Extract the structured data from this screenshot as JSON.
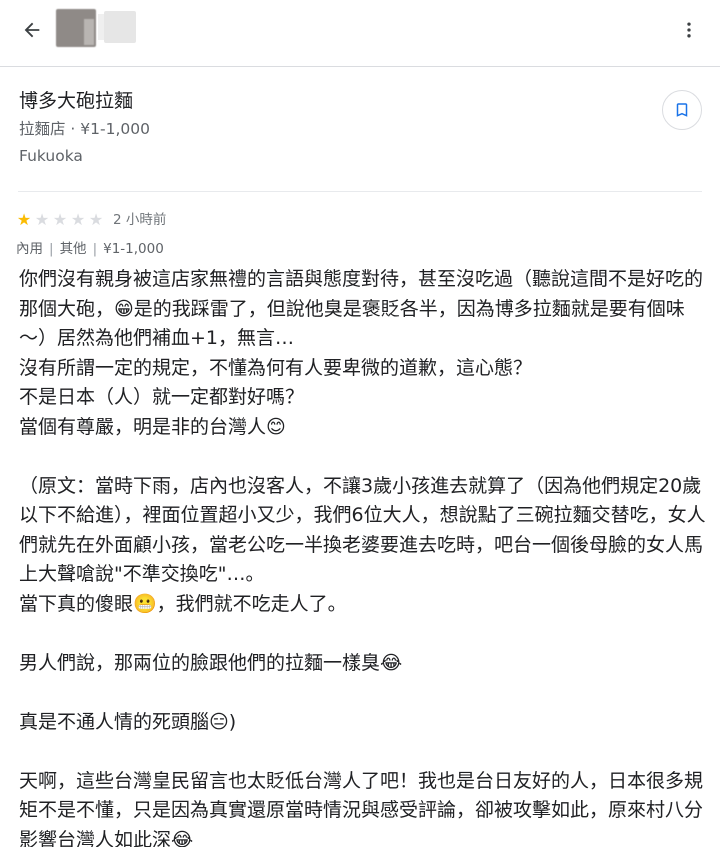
{
  "header": {
    "back_icon": "arrow-left-icon",
    "more_icon": "more-vert-icon"
  },
  "place": {
    "name": "博多大砲拉麵",
    "meta": "拉麵店 · ¥1-1,000",
    "city": "Fukuoka",
    "save_icon": "bookmark-icon"
  },
  "review": {
    "rating": 1,
    "max_rating": 5,
    "time": "2 小時前",
    "tags": [
      "內用",
      "其他",
      "¥1-1,000"
    ],
    "paragraphs": [
      "你們沒有親身被這店家無禮的言語與態度對待，甚至沒吃過（聽說這間不是好吃的那個大砲，😁是的我踩雷了，但說他臭是褒貶各半，因為博多拉麵就是要有個味～）居然為他們補血+1，無言…\n沒有所謂一定的規定，不懂為何有人要卑微的道歉，這心態？\n不是日本（人）就一定都對好嗎？\n當個有尊嚴，明是非的台灣人😊",
      "（原文：當時下雨，店內也沒客人，不讓3歲小孩進去就算了（因為他們規定20歲以下不給進），裡面位置超小又少，我們6位大人，想說點了三碗拉麵交替吃，女人們就先在外面顧小孩，當老公吃一半換老婆要進去吃時，吧台一個後母臉的女人馬上大聲嗆說\"不準交換吃\"…。\n當下真的傻眼😬，我們就不吃走人了。",
      "男人們說，那兩位的臉跟他們的拉麵一樣臭😂",
      "真是不通人情的死頭腦😑)",
      "天啊，這些台灣皇民留言也太貶低台灣人了吧！我也是台日友好的人，日本很多規矩不是不懂，只是因為真實還原當時情況與感受評論，卻被攻擊如此，原來村八分影響台灣人如此深😂"
    ]
  },
  "colors": {
    "star_on": "#fbbc04",
    "star_off": "#dadce0",
    "accent": "#1a73e8"
  }
}
